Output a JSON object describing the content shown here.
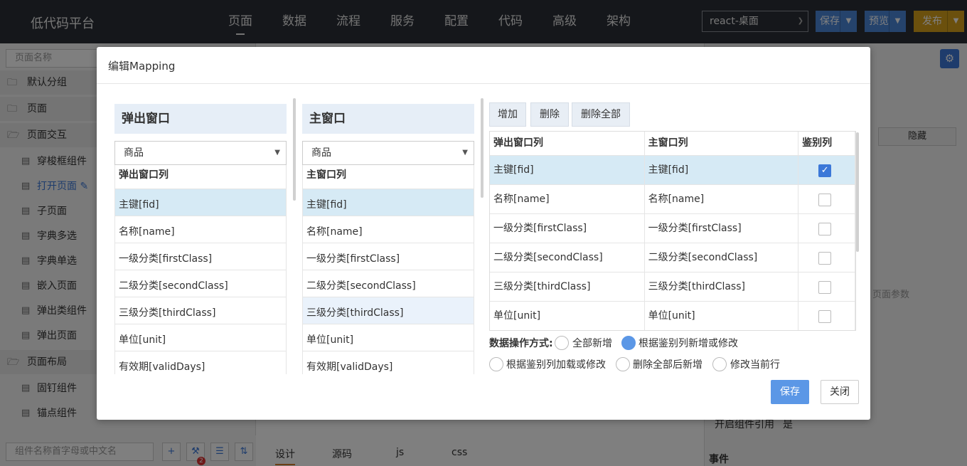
{
  "topbar": {
    "logo": "低代码平台",
    "nav": [
      "页面",
      "数据",
      "流程",
      "服务",
      "配置",
      "代码",
      "高级",
      "架构"
    ],
    "env": "react-桌面",
    "save": "保存",
    "preview": "预览",
    "publish": "发布"
  },
  "left": {
    "search_placeholder": "页面名称",
    "groups": [
      "默认分组",
      "页面",
      "页面交互",
      "页面布局"
    ],
    "items": [
      "穿梭框组件",
      "打开页面",
      "子页面",
      "字典多选",
      "字典单选",
      "嵌入页面",
      "弹出类组件",
      "弹出页面"
    ],
    "layout_items": [
      "固钉组件",
      "锚点组件"
    ],
    "bottom_search_placeholder": "组件名称首字母或中文名",
    "badge": "2"
  },
  "center_tabs": [
    "设计",
    "源码",
    "js",
    "css"
  ],
  "right": {
    "hide_btn": "隐藏",
    "param": "页面参数",
    "ref_label": "开启组件引用",
    "ref_value": "是",
    "events": "事件",
    "expr": "{/}"
  },
  "modal": {
    "title": "编辑Mapping",
    "popup": {
      "title": "弹出窗口",
      "select": "商品",
      "col_header": "弹出窗口列",
      "rows": [
        "主键[fid]",
        "名称[name]",
        "一级分类[firstClass]",
        "二级分类[secondClass]",
        "三级分类[thirdClass]",
        "单位[unit]",
        "有效期[validDays]"
      ]
    },
    "main": {
      "title": "主窗口",
      "select": "商品",
      "col_header": "主窗口列",
      "rows": [
        "主键[fid]",
        "名称[name]",
        "一级分类[firstClass]",
        "二级分类[secondClass]",
        "三级分类[thirdClass]",
        "单位[unit]",
        "有效期[validDays]"
      ]
    },
    "actions": {
      "add": "增加",
      "delete": "删除",
      "delete_all": "删除全部"
    },
    "table": {
      "headers": [
        "弹出窗口列",
        "主窗口列",
        "鉴别列"
      ],
      "rows": [
        {
          "popup": "主键[fid]",
          "main": "主键[fid]",
          "key": true
        },
        {
          "popup": "名称[name]",
          "main": "名称[name]",
          "key": false
        },
        {
          "popup": "一级分类[firstClass]",
          "main": "一级分类[firstClass]",
          "key": false
        },
        {
          "popup": "二级分类[secondClass]",
          "main": "二级分类[secondClass]",
          "key": false
        },
        {
          "popup": "三级分类[thirdClass]",
          "main": "三级分类[thirdClass]",
          "key": false
        },
        {
          "popup": "单位[unit]",
          "main": "单位[unit]",
          "key": false
        }
      ]
    },
    "ops_label": "数据操作方式:",
    "ops": [
      "全部新增",
      "根据鉴别列新增或修改",
      "根据鉴别列加载或修改",
      "删除全部后新增",
      "修改当前行"
    ],
    "ops_selected": "根据鉴别列新增或修改",
    "check_mark": "✓",
    "save": "保存",
    "close": "关闭"
  }
}
